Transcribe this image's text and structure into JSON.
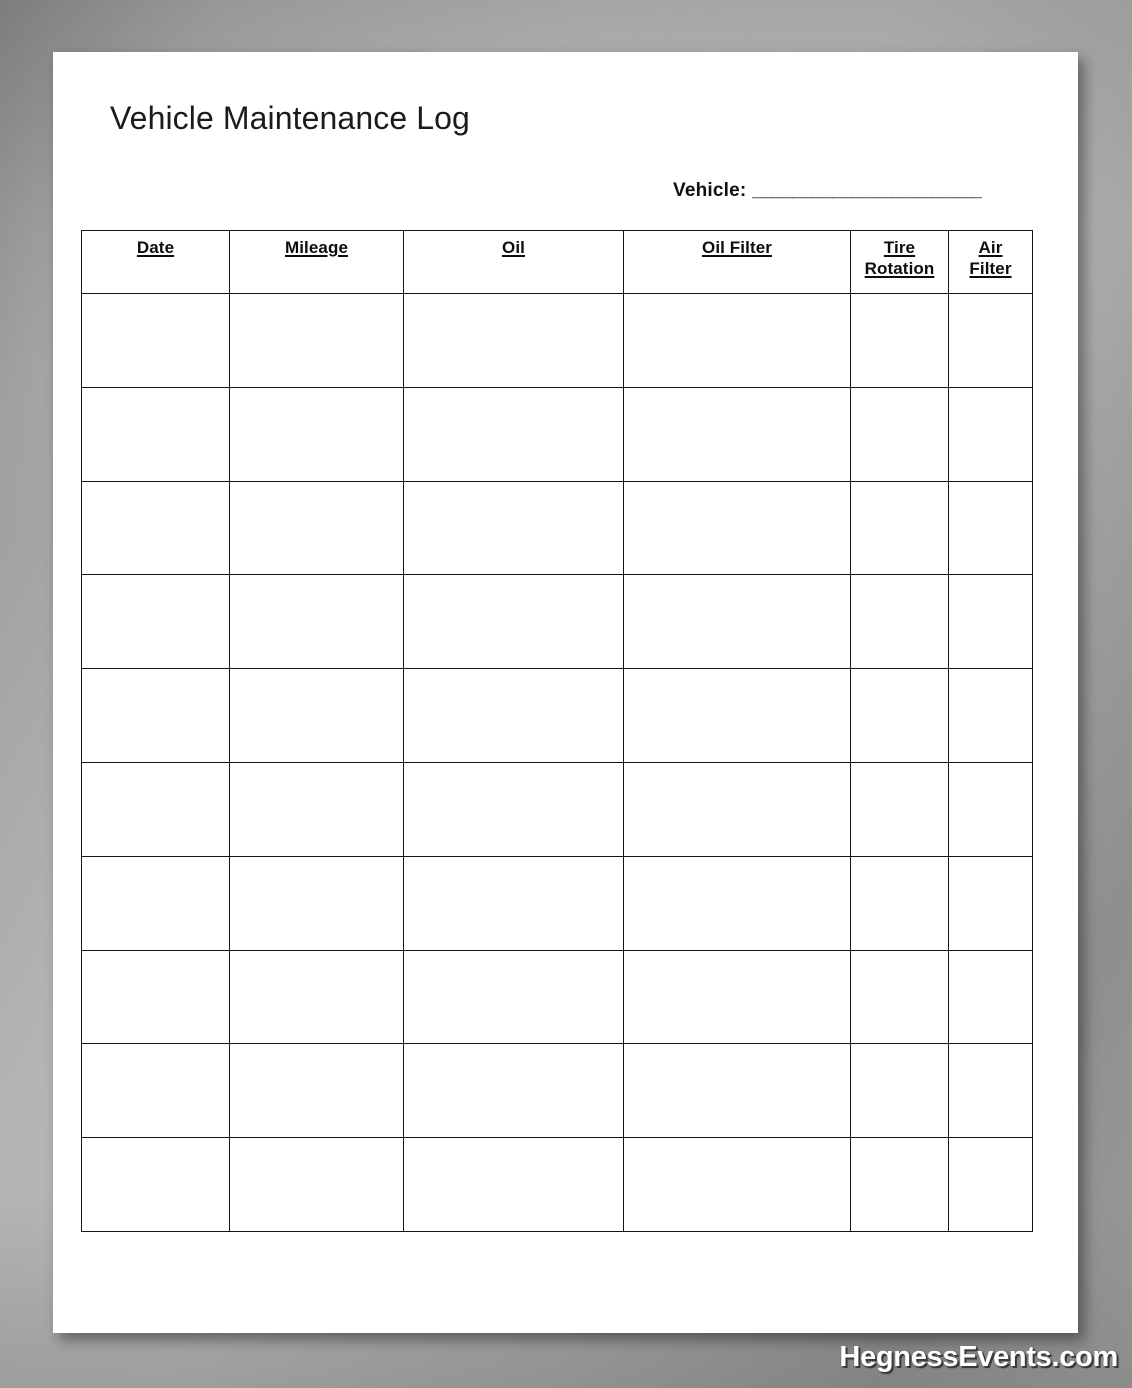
{
  "document": {
    "title": "Vehicle Maintenance Log",
    "vehicle_field": {
      "label": "Vehicle:",
      "value": "",
      "blank_line": "_______________________"
    }
  },
  "table": {
    "columns": [
      {
        "key": "date",
        "label": "Date",
        "lines": [
          "Date"
        ]
      },
      {
        "key": "mileage",
        "label": "Mileage",
        "lines": [
          "Mileage"
        ]
      },
      {
        "key": "oil",
        "label": "Oil",
        "lines": [
          "Oil"
        ]
      },
      {
        "key": "oil_filter",
        "label": "Oil Filter",
        "lines": [
          "Oil Filter"
        ]
      },
      {
        "key": "tire_rotation",
        "label": "Tire Rotation",
        "lines": [
          "Tire",
          "Rotation"
        ]
      },
      {
        "key": "air_filter",
        "label": "Air Filter",
        "lines": [
          "Air",
          "Filter"
        ]
      }
    ],
    "row_count": 10,
    "rows": [
      {
        "date": "",
        "mileage": "",
        "oil": "",
        "oil_filter": "",
        "tire_rotation": "",
        "air_filter": ""
      },
      {
        "date": "",
        "mileage": "",
        "oil": "",
        "oil_filter": "",
        "tire_rotation": "",
        "air_filter": ""
      },
      {
        "date": "",
        "mileage": "",
        "oil": "",
        "oil_filter": "",
        "tire_rotation": "",
        "air_filter": ""
      },
      {
        "date": "",
        "mileage": "",
        "oil": "",
        "oil_filter": "",
        "tire_rotation": "",
        "air_filter": ""
      },
      {
        "date": "",
        "mileage": "",
        "oil": "",
        "oil_filter": "",
        "tire_rotation": "",
        "air_filter": ""
      },
      {
        "date": "",
        "mileage": "",
        "oil": "",
        "oil_filter": "",
        "tire_rotation": "",
        "air_filter": ""
      },
      {
        "date": "",
        "mileage": "",
        "oil": "",
        "oil_filter": "",
        "tire_rotation": "",
        "air_filter": ""
      },
      {
        "date": "",
        "mileage": "",
        "oil": "",
        "oil_filter": "",
        "tire_rotation": "",
        "air_filter": ""
      },
      {
        "date": "",
        "mileage": "",
        "oil": "",
        "oil_filter": "",
        "tire_rotation": "",
        "air_filter": ""
      },
      {
        "date": "",
        "mileage": "",
        "oil": "",
        "oil_filter": "",
        "tire_rotation": "",
        "air_filter": ""
      }
    ]
  },
  "watermark": {
    "text": "HegnessEvents.com"
  },
  "colors": {
    "paper": "#ffffff",
    "ink": "#111111",
    "border": "#151515",
    "backdrop": "#ababab",
    "watermark_text": "#ffffff"
  }
}
